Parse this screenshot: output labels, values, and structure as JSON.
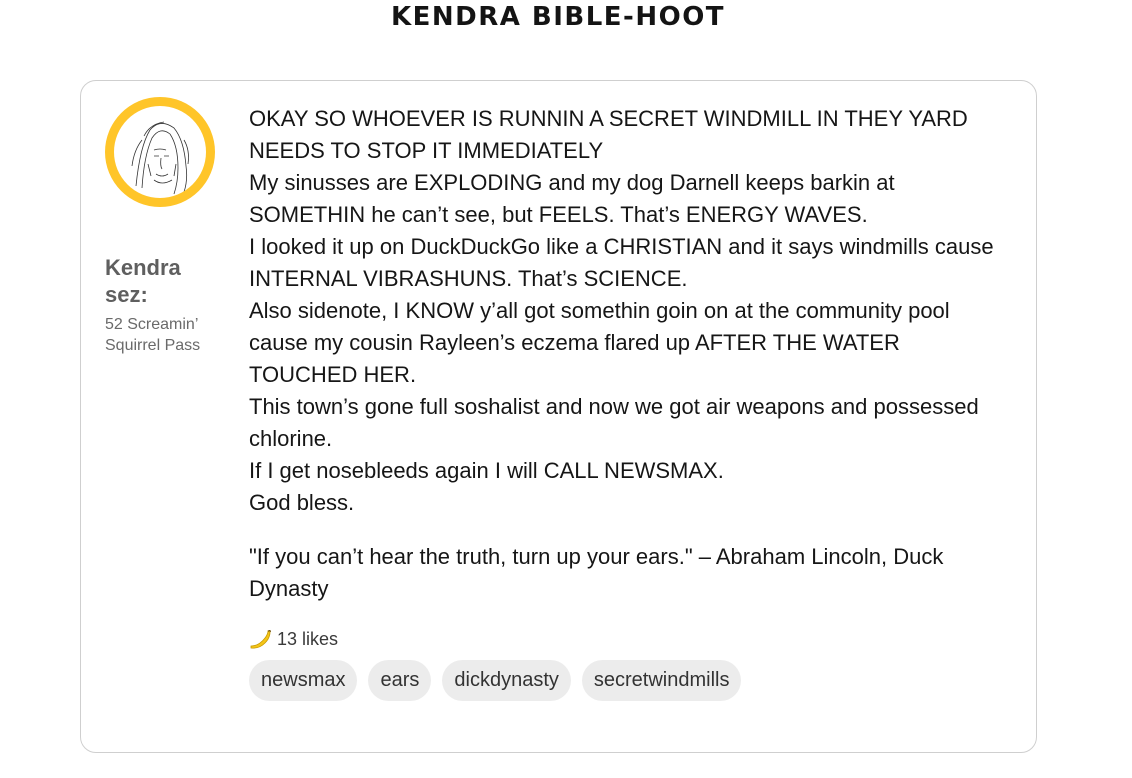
{
  "page": {
    "title": "KENDRA BIBLE-HOOT"
  },
  "author": {
    "name": "Kendra sez:",
    "address": "52 Screamin’ Squirrel Pass",
    "avatar_icon": "portrait-sketch",
    "avatar_ring_color": "#ffc529"
  },
  "post": {
    "lines": [
      "OKAY SO WHOEVER IS RUNNIN A SECRET WINDMILL IN THEY YARD NEEDS TO STOP IT IMMEDIATELY",
      "My sinusses are EXPLODING and my dog Darnell keeps barkin at SOMETHIN he can’t see, but FEELS. That’s ENERGY WAVES.",
      "I looked it up on DuckDuckGo like a CHRISTIAN and it says windmills cause INTERNAL VIBRASHUNS. That’s SCIENCE.",
      "Also sidenote, I KNOW y’all got somethin goin on at the community pool cause my cousin Rayleen’s eczema flared up AFTER THE WATER TOUCHED HER.",
      "This town’s gone full soshalist and now we got air weapons and possessed chlorine.",
      "If I get nosebleeds again I will CALL NEWSMAX.",
      "God bless."
    ],
    "quote": "\"If you can’t hear the truth, turn up your ears.\" – Abraham Lincoln, Duck Dynasty"
  },
  "likes": {
    "icon": "banana-icon",
    "label": "13 likes"
  },
  "tags": [
    "newsmax",
    "ears",
    "dickdynasty",
    "secretwindmills"
  ]
}
